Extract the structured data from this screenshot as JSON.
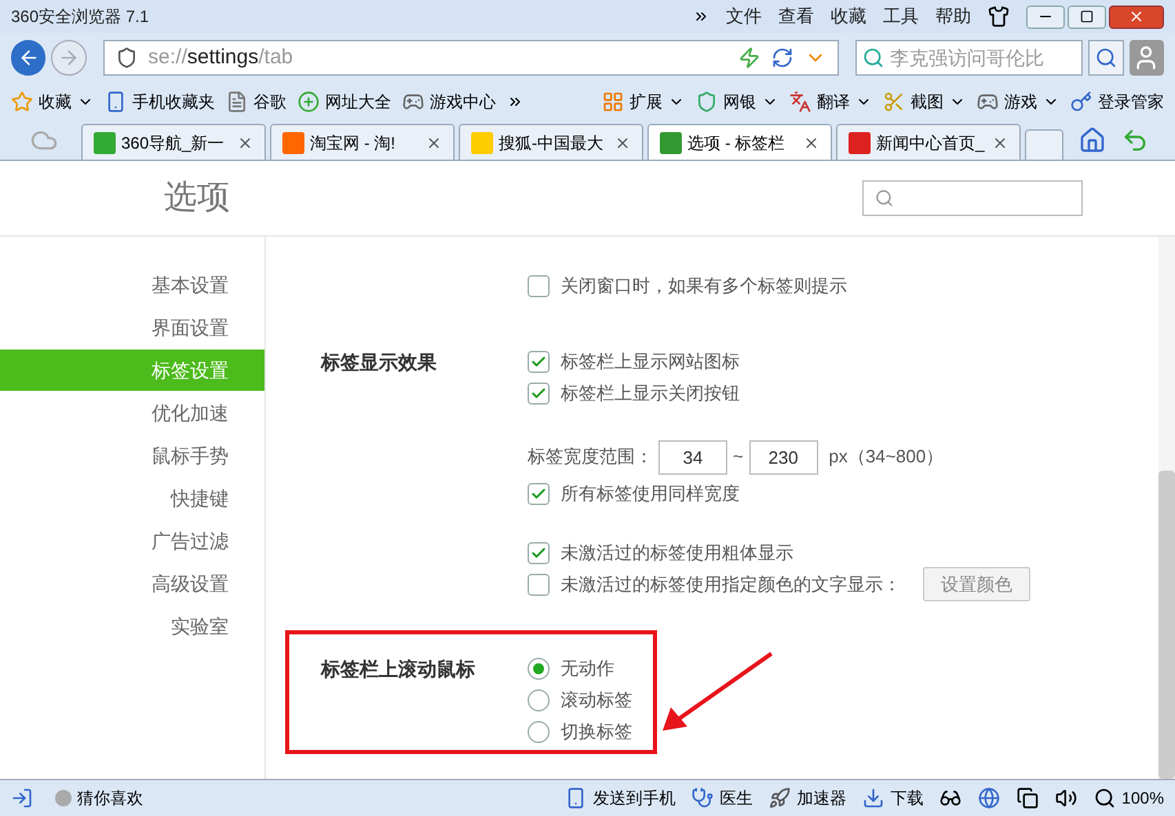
{
  "window": {
    "title": "360安全浏览器 7.1",
    "menu": [
      "文件",
      "查看",
      "收藏",
      "工具",
      "帮助"
    ]
  },
  "address": {
    "scheme": "se://",
    "host": "settings",
    "path": "/tab"
  },
  "search": {
    "value": "李克强访问哥伦比"
  },
  "bookmarks": [
    {
      "label": "收藏"
    },
    {
      "label": "手机收藏夹"
    },
    {
      "label": "谷歌"
    },
    {
      "label": "网址大全"
    },
    {
      "label": "游戏中心"
    }
  ],
  "tools": [
    {
      "label": "扩展"
    },
    {
      "label": "网银"
    },
    {
      "label": "翻译"
    },
    {
      "label": "截图"
    },
    {
      "label": "游戏"
    },
    {
      "label": "登录管家"
    }
  ],
  "tabs": [
    {
      "label": "360导航_新一",
      "selected": false
    },
    {
      "label": "淘宝网 - 淘!",
      "selected": false
    },
    {
      "label": "搜狐-中国最大",
      "selected": false
    },
    {
      "label": "选项 - 标签栏",
      "selected": true
    },
    {
      "label": "新闻中心首页_",
      "selected": false
    }
  ],
  "settings": {
    "title": "选项",
    "sidebar": [
      {
        "label": "基本设置",
        "selected": false
      },
      {
        "label": "界面设置",
        "selected": false
      },
      {
        "label": "标签设置",
        "selected": true
      },
      {
        "label": "优化加速",
        "selected": false
      },
      {
        "label": "鼠标手势",
        "selected": false
      },
      {
        "label": "快捷键",
        "selected": false
      },
      {
        "label": "广告过滤",
        "selected": false
      },
      {
        "label": "高级设置",
        "selected": false
      },
      {
        "label": "实验室",
        "selected": false
      }
    ],
    "sections": [
      {
        "annotated": false,
        "groups": [
          [
            {
              "kind": "checkbox",
              "label": "关闭窗口时，如果有多个标签则提示",
              "checked": false
            }
          ]
        ]
      },
      {
        "heading": "标签显示效果",
        "annotated": false,
        "groups": [
          [
            {
              "kind": "checkbox",
              "label": "标签栏上显示网站图标",
              "checked": true
            },
            {
              "kind": "checkbox",
              "label": "标签栏上显示关闭按钮",
              "checked": true
            }
          ],
          [
            {
              "kind": "range",
              "label": "标签宽度范围：",
              "min": "34",
              "sep": "~",
              "max": "230",
              "hint": "px（34~800）"
            },
            {
              "kind": "checkbox",
              "label": "所有标签使用同样宽度",
              "checked": true
            }
          ],
          [
            {
              "kind": "checkbox",
              "label": "未激活过的标签使用粗体显示",
              "checked": true
            },
            {
              "kind": "checkbox",
              "label": "未激活过的标签使用指定颜色的文字显示：",
              "checked": false,
              "button": "设置颜色"
            }
          ]
        ]
      },
      {
        "heading": "标签栏上滚动鼠标",
        "annotated": true,
        "groups": [
          [
            {
              "kind": "radio",
              "label": "无动作",
              "selected": true
            },
            {
              "kind": "radio",
              "label": "滚动标签",
              "selected": false
            },
            {
              "kind": "radio",
              "label": "切换标签",
              "selected": false
            }
          ]
        ]
      }
    ]
  },
  "status": {
    "left": "猜你喜欢",
    "items": [
      "发送到手机",
      "医生",
      "加速器",
      "下载"
    ],
    "zoom": "100%"
  }
}
